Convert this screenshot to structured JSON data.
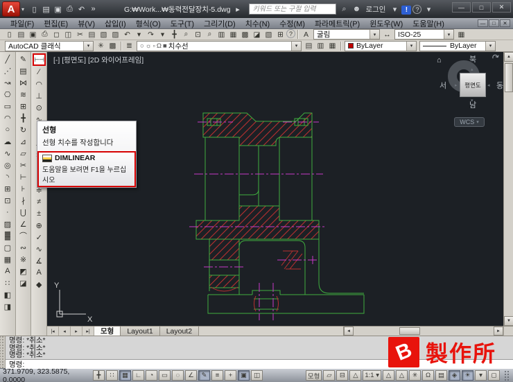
{
  "colors": {
    "canvas-bg": "#1c2025",
    "line-green": "#3fae3f",
    "hatch-red": "#b83030",
    "centerline-magenta": "#c93ac9",
    "highlight-red": "#d60000",
    "watermark-red": "#e8130c"
  },
  "titlebar": {
    "logo_letter": "A",
    "quick_access": [
      {
        "n": "new-file-icon",
        "g": "▯"
      },
      {
        "n": "open-file-icon",
        "g": "▤"
      },
      {
        "n": "save-icon",
        "g": "▣"
      },
      {
        "n": "plot-icon",
        "g": "⎙"
      },
      {
        "n": "undo-icon",
        "g": "↶"
      },
      {
        "n": "toolbar-expand-icon",
        "g": "»"
      }
    ],
    "doc_title": "G:₩Work...₩동력전달장치-5.dwg",
    "doc_expand": [
      {
        "n": "doc-title-expand-icon",
        "g": "▸"
      }
    ],
    "search_placeholder": "키워드 또는 구절 입력",
    "right_icons_a": [
      {
        "n": "search-binoculars-icon",
        "g": "⌕"
      },
      {
        "n": "login-user-icon",
        "g": "☻"
      }
    ],
    "login_label": "로그인",
    "right_icons_b": [
      {
        "n": "login-dropdown-icon",
        "g": "▾"
      },
      {
        "n": "autodesk-exchange-icon",
        "g": "!"
      },
      {
        "n": "help-icon",
        "g": "?"
      },
      {
        "n": "help-dropdown-icon",
        "g": "▾"
      }
    ],
    "window_controls": [
      {
        "n": "minimize-button",
        "g": "—"
      },
      {
        "n": "restore-button",
        "g": "□"
      },
      {
        "n": "close-button",
        "g": "✕"
      }
    ]
  },
  "menubar": {
    "items": [
      "파일(F)",
      "편집(E)",
      "뷰(V)",
      "삽입(I)",
      "형식(O)",
      "도구(T)",
      "그리기(D)",
      "치수(N)",
      "수정(M)",
      "파라메트릭(P)",
      "윈도우(W)",
      "도움말(H)"
    ],
    "doc_controls": [
      {
        "n": "doc-minimize-button",
        "g": "—"
      },
      {
        "n": "doc-restore-button",
        "g": "□"
      },
      {
        "n": "doc-close-button",
        "g": "✕"
      }
    ]
  },
  "toolbar1": {
    "icons": [
      {
        "n": "new-file-icon",
        "g": "▯"
      },
      {
        "n": "open-file-icon",
        "g": "▤"
      },
      {
        "n": "save-icon",
        "g": "▣"
      },
      {
        "n": "plot-icon",
        "g": "⎙"
      },
      {
        "n": "plot-preview-icon",
        "g": "◻"
      },
      {
        "n": "publish-icon",
        "g": "◫"
      },
      {
        "n": "cut-icon",
        "g": "✂"
      },
      {
        "n": "copy-icon",
        "g": "▤"
      },
      {
        "n": "paste-icon",
        "g": "▧"
      },
      {
        "n": "match-properties-icon",
        "g": "▨"
      },
      {
        "n": "undo-icon",
        "g": "↶"
      },
      {
        "n": "undo-dropdown-icon",
        "g": "▾"
      },
      {
        "n": "redo-icon",
        "g": "↷"
      },
      {
        "n": "redo-dropdown-icon",
        "g": "▾"
      },
      {
        "n": "pan-icon",
        "g": "╋"
      },
      {
        "n": "zoom-realtime-icon",
        "g": "⌕"
      },
      {
        "n": "zoom-window-icon",
        "g": "⊡"
      },
      {
        "n": "zoom-previous-icon",
        "g": "⌕"
      },
      {
        "n": "properties-icon",
        "g": "▥"
      },
      {
        "n": "designcenter-icon",
        "g": "▦"
      },
      {
        "n": "tool-palettes-icon",
        "g": "▩"
      },
      {
        "n": "sheet-set-manager-icon",
        "g": "◪"
      },
      {
        "n": "markup-set-manager-icon",
        "g": "▧"
      },
      {
        "n": "quickcalc-icon",
        "g": "⊞"
      },
      {
        "n": "help-icon",
        "g": "?"
      }
    ],
    "text_style_icons": [
      {
        "n": "text-style-icon",
        "g": "A"
      }
    ],
    "text_style": "굴림",
    "dim_style_icons": [
      {
        "n": "dimension-style-icon",
        "g": "↔"
      }
    ],
    "dim_style": "ISO-25",
    "table_style_icons": [
      {
        "n": "table-style-icon",
        "g": "▦"
      }
    ]
  },
  "toolbar2": {
    "workspace": "AutoCAD 클래식",
    "workspace_icons": [
      {
        "n": "workspace-settings-icon",
        "g": "✳"
      },
      {
        "n": "save-workspace-icon",
        "g": "▩"
      }
    ],
    "layer_prefix_icons": [
      {
        "n": "layer-properties-icon",
        "g": "≣"
      }
    ],
    "layer_combo_icons": [
      {
        "n": "layer-on-icon",
        "g": "○"
      },
      {
        "n": "layer-sun-icon",
        "g": "☼"
      },
      {
        "n": "layer-freeze-icon",
        "g": "▫"
      },
      {
        "n": "layer-lock-icon",
        "g": "Ω"
      },
      {
        "n": "layer-color-swatch-icon",
        "g": "■"
      }
    ],
    "layer_name": "치수선",
    "layer_tools": [
      {
        "n": "make-object-layer-current-icon",
        "g": "▤"
      },
      {
        "n": "layer-previous-icon",
        "g": "▥"
      },
      {
        "n": "layer-states-icon",
        "g": "▦"
      }
    ],
    "color_label": "ByLayer",
    "linetype_label": "ByLayer"
  },
  "left_toolbars": {
    "draw": [
      {
        "n": "line-icon",
        "g": "╱"
      },
      {
        "n": "construction-line-icon",
        "g": "⋰"
      },
      {
        "n": "polyline-icon",
        "g": "↝"
      },
      {
        "n": "polygon-icon",
        "g": "⎔"
      },
      {
        "n": "rectangle-icon",
        "g": "▭"
      },
      {
        "n": "arc-icon",
        "g": "◠"
      },
      {
        "n": "circle-icon",
        "g": "○"
      },
      {
        "n": "revision-cloud-icon",
        "g": "☁"
      },
      {
        "n": "spline-icon",
        "g": "∿"
      },
      {
        "n": "ellipse-icon",
        "g": "◎"
      },
      {
        "n": "ellipse-arc-icon",
        "g": "◝"
      },
      {
        "n": "insert-block-icon",
        "g": "⊞"
      },
      {
        "n": "make-block-icon",
        "g": "⊡"
      },
      {
        "n": "point-icon",
        "g": "∙"
      },
      {
        "n": "hatch-icon",
        "g": "▨"
      },
      {
        "n": "gradient-icon",
        "g": "▓"
      },
      {
        "n": "region-icon",
        "g": "▢"
      },
      {
        "n": "table-icon",
        "g": "▦"
      },
      {
        "n": "multiline-text-icon",
        "g": "A"
      },
      {
        "n": "point-style-icon",
        "g": "∷"
      },
      {
        "n": "draw-order-front-icon",
        "g": "◧"
      },
      {
        "n": "draw-order-back-icon",
        "g": "◨"
      }
    ],
    "modify": [
      {
        "n": "erase-icon",
        "g": "✎"
      },
      {
        "n": "copy-icon",
        "g": "▤"
      },
      {
        "n": "mirror-icon",
        "g": "⋈"
      },
      {
        "n": "offset-icon",
        "g": "≋"
      },
      {
        "n": "array-icon",
        "g": "⊞"
      },
      {
        "n": "move-icon",
        "g": "╋"
      },
      {
        "n": "rotate-icon",
        "g": "↻"
      },
      {
        "n": "scale-icon",
        "g": "⊿"
      },
      {
        "n": "stretch-icon",
        "g": "▱"
      },
      {
        "n": "trim-icon",
        "g": "✂"
      },
      {
        "n": "extend-icon",
        "g": "⊢"
      },
      {
        "n": "break-at-point-icon",
        "g": "⊦"
      },
      {
        "n": "break-icon",
        "g": "∤"
      },
      {
        "n": "join-icon",
        "g": "⋃"
      },
      {
        "n": "chamfer-icon",
        "g": "∠"
      },
      {
        "n": "fillet-icon",
        "g": "⌒"
      },
      {
        "n": "blend-icon",
        "g": "∾"
      },
      {
        "n": "explode-icon",
        "g": "※"
      },
      {
        "n": "draw-order-above-icon",
        "g": "◩"
      },
      {
        "n": "draw-order-below-icon",
        "g": "◪"
      }
    ],
    "dimension": [
      {
        "n": "linear-dimension-icon",
        "g": "⊢⊣",
        "hl": true
      },
      {
        "n": "aligned-dimension-icon",
        "g": "∕"
      },
      {
        "n": "arc-length-dimension-icon",
        "g": "◠"
      },
      {
        "n": "ordinate-dimension-icon",
        "g": "⊥"
      },
      {
        "n": "radius-dimension-icon",
        "g": "⊙"
      },
      {
        "n": "jogged-dimension-icon",
        "g": "∿"
      },
      {
        "n": "diameter-dimension-icon",
        "g": "⌀"
      },
      {
        "n": "angular-dimension-icon",
        "g": "∠"
      },
      {
        "n": "quick-dimension-icon",
        "g": "≍"
      },
      {
        "n": "baseline-dimension-icon",
        "g": "≡"
      },
      {
        "n": "continue-dimension-icon",
        "g": "∥"
      },
      {
        "n": "dimension-space-icon",
        "g": "≑"
      },
      {
        "n": "dimension-break-icon",
        "g": "≠"
      },
      {
        "n": "tolerance-icon",
        "g": "±"
      },
      {
        "n": "center-mark-icon",
        "g": "⊕"
      },
      {
        "n": "inspection-icon",
        "g": "✓"
      },
      {
        "n": "jogged-linear-icon",
        "g": "∿"
      },
      {
        "n": "oblique-dimension-icon",
        "g": "∡"
      },
      {
        "n": "dimension-text-edit-icon",
        "g": "A"
      },
      {
        "n": "dimension-style-icon",
        "g": "◆"
      }
    ]
  },
  "canvas": {
    "viewport_label": "[-] [평면도] [2D 와이어프레임]",
    "viewcube": {
      "north": "북",
      "south": "남",
      "west": "서",
      "east": "동",
      "center": "평면도",
      "wcs": "WCS"
    },
    "ucs": {
      "x": "X",
      "y": "Y"
    }
  },
  "tooltip": {
    "title": "선형",
    "description": "선형 치수를 작성합니다",
    "command": "DIMLINEAR",
    "help": "도움말을 보려면 F1을 누르십시오"
  },
  "tabsbar": {
    "nav": [
      {
        "n": "first-tab-button",
        "g": "|◂"
      },
      {
        "n": "prev-tab-button",
        "g": "◂"
      },
      {
        "n": "next-tab-button",
        "g": "▸"
      },
      {
        "n": "last-tab-button",
        "g": "▸|"
      }
    ],
    "tabs": [
      {
        "n": "tab-model",
        "label": "모형",
        "on": true
      },
      {
        "n": "tab-layout1",
        "label": "Layout1"
      },
      {
        "n": "tab-layout2",
        "label": "Layout2"
      }
    ]
  },
  "command": {
    "history": [
      "명령: *취소*",
      "명령: *취소*",
      "명령: *취소*"
    ],
    "prompt": "명령:"
  },
  "watermark": {
    "letter": "B",
    "label": "製作所"
  },
  "statusbar": {
    "coordinates": "371.9709, 323.5875, 0.0000",
    "toggles": [
      {
        "n": "snap-toggle",
        "g": "╋"
      },
      {
        "n": "grid-toggle",
        "g": "∷"
      },
      {
        "n": "grid-display-toggle",
        "g": "▦",
        "on": true
      },
      {
        "n": "ortho-toggle",
        "g": "∟"
      },
      {
        "n": "polar-tracking-toggle",
        "g": "◔"
      },
      {
        "n": "osnap-toggle",
        "g": "▭"
      },
      {
        "n": "object-snap-tracking-toggle",
        "g": "◌"
      },
      {
        "n": "dynamic-ucs-toggle",
        "g": "∠"
      },
      {
        "n": "dynamic-input-toggle",
        "g": "✎",
        "on": true
      },
      {
        "n": "lineweight-toggle",
        "g": "≡"
      },
      {
        "n": "transparency-toggle",
        "g": "+"
      },
      {
        "n": "quick-properties-toggle",
        "g": "▣",
        "on": true
      },
      {
        "n": "selection-cycling-toggle",
        "g": "◫"
      }
    ],
    "right_items": [
      {
        "n": "model-space-button",
        "label": "모형"
      },
      {
        "n": "quick-view-layouts-icon",
        "g": "▱"
      },
      {
        "n": "quick-view-drawings-icon",
        "g": "⊟"
      },
      {
        "n": "annotation-scale-icon",
        "g": "△"
      },
      {
        "n": "annotation-scale-button",
        "label": "1:1 ▾"
      },
      {
        "n": "annotation-visibility-icon",
        "g": "△"
      },
      {
        "n": "annotation-autoscale-icon",
        "g": "△"
      },
      {
        "n": "workspace-switching-icon",
        "g": "✳"
      },
      {
        "n": "toolbar-lock-icon",
        "g": "Ω"
      },
      {
        "n": "status-toolbar-icon",
        "g": "▤"
      },
      {
        "n": "hardware-acceleration-icon",
        "g": "◈",
        "on": true
      },
      {
        "n": "performance-bulb-icon",
        "g": "☀",
        "on": true
      },
      {
        "n": "status-menu-arrow-icon",
        "g": "▾"
      },
      {
        "n": "clean-screen-button",
        "g": "◻"
      }
    ]
  }
}
